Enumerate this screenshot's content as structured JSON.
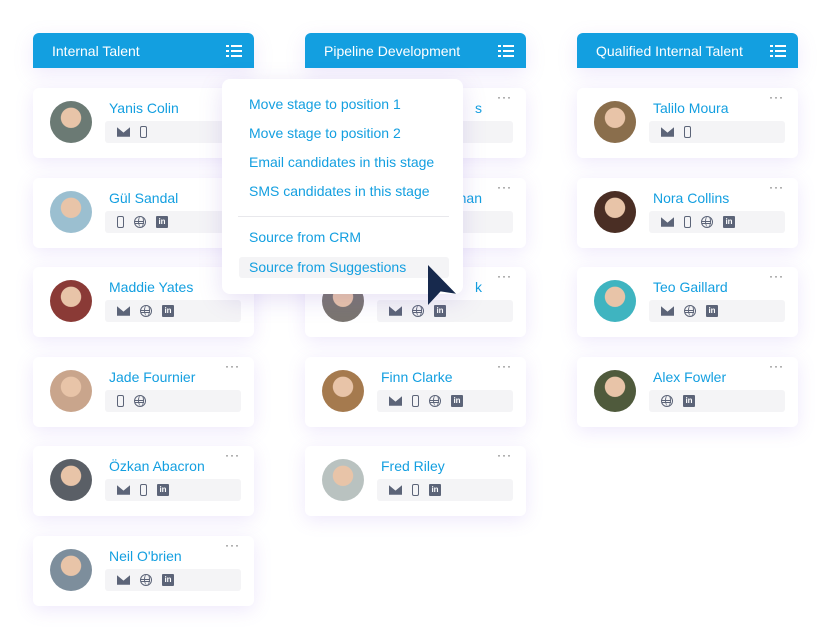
{
  "columns": [
    {
      "title": "Internal Talent",
      "cards": [
        {
          "name": "Yanis Colin",
          "icons": [
            "mail",
            "phone"
          ],
          "color": "#6b7a74"
        },
        {
          "name": "Gül Sandal",
          "icons": [
            "phone",
            "globe",
            "linkedin"
          ],
          "color": "#9bbfd0"
        },
        {
          "name": "Maddie Yates",
          "icons": [
            "mail",
            "globe",
            "linkedin"
          ],
          "color": "#8a3a36"
        },
        {
          "name": "Jade Fournier",
          "icons": [
            "phone",
            "globe"
          ],
          "color": "#c9a58c"
        },
        {
          "name": "Özkan Abacron",
          "icons": [
            "mail",
            "phone",
            "linkedin"
          ],
          "color": "#5a5f66"
        },
        {
          "name": "Neil O'brien",
          "icons": [
            "mail",
            "globe",
            "linkedin"
          ],
          "color": "#7d8e9c"
        }
      ]
    },
    {
      "title": "Pipeline Development",
      "cards": [
        {
          "name": "s",
          "icons": [],
          "color": "#999"
        },
        {
          "name": "nan",
          "icons": [],
          "color": "#999"
        },
        {
          "name": "k",
          "icons": [
            "mail",
            "globe",
            "linkedin"
          ],
          "color": "#7a7570"
        },
        {
          "name": "Finn Clarke",
          "icons": [
            "mail",
            "phone",
            "globe",
            "linkedin"
          ],
          "color": "#a57a4e"
        },
        {
          "name": "Fred Riley",
          "icons": [
            "mail",
            "phone",
            "linkedin"
          ],
          "color": "#b9c2c0"
        }
      ]
    },
    {
      "title": "Qualified Internal Talent",
      "cards": [
        {
          "name": "Talilo Moura",
          "icons": [
            "mail",
            "phone"
          ],
          "color": "#8a6e4c"
        },
        {
          "name": "Nora Collins",
          "icons": [
            "mail",
            "phone",
            "globe",
            "linkedin"
          ],
          "color": "#4a2e24"
        },
        {
          "name": "Teo Gaillard",
          "icons": [
            "mail",
            "globe",
            "linkedin"
          ],
          "color": "#3fb4c0"
        },
        {
          "name": "Alex Fowler",
          "icons": [
            "globe",
            "linkedin"
          ],
          "color": "#4f5a3c"
        }
      ]
    }
  ],
  "menu": {
    "items": [
      "Move stage to position 1",
      "Move stage to position 2",
      "Email candidates in this stage",
      "SMS candidates in this stage",
      "Source from CRM",
      "Source from Suggestions"
    ],
    "highlighted": "Source from Suggestions"
  },
  "more_label": "···",
  "linkedin_label": "in",
  "accent": "#139fe0"
}
